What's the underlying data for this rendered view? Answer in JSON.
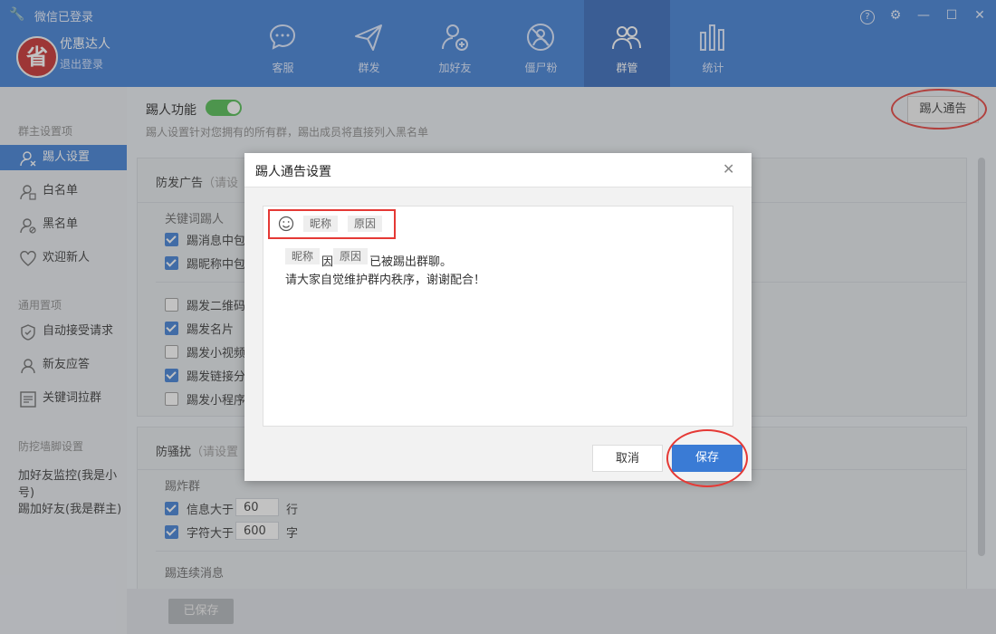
{
  "app": {
    "title": "微信已登录",
    "user_name": "优惠达人",
    "logout": "退出登录",
    "avatar_text": "省"
  },
  "nav_tabs": [
    {
      "label": "客服",
      "icon": "chat-icon"
    },
    {
      "label": "群发",
      "icon": "send-icon"
    },
    {
      "label": "加好友",
      "icon": "add-friend-icon"
    },
    {
      "label": "僵尸粉",
      "icon": "zombie-fan-icon"
    },
    {
      "label": "群管",
      "icon": "group-manage-icon",
      "active": true
    },
    {
      "label": "统计",
      "icon": "stats-icon"
    }
  ],
  "window_controls": {
    "help": "?",
    "settings": "⚙",
    "minimize": "—",
    "maximize": "☐",
    "close": "✕"
  },
  "sidebar": {
    "section1": "群主设置项",
    "items1": [
      "踢人设置",
      "白名单",
      "黑名单",
      "欢迎新人"
    ],
    "section2": "通用置项",
    "items2": [
      "自动接受请求",
      "新友应答",
      "关键词拉群"
    ],
    "section3": "防挖墙脚设置",
    "items3": [
      "加好友监控(我是小号)",
      "踢加好友(我是群主)"
    ]
  },
  "main": {
    "kick_title": "踢人功能",
    "kick_desc": "踢人设置针对您拥有的所有群，踢出成员将直接列入黑名单",
    "notice_button": "踢人通告",
    "anti_ad_title": "防发广告",
    "anti_ad_hint": "（请设",
    "keyword_kick": "关键词踢人",
    "kick_msg": "踢消息中包含",
    "kick_nick": "踢昵称中包含",
    "kick_qr": "踢发二维码(",
    "kick_card": "踢发名片",
    "kick_video": "踢发小视频",
    "kick_link": "踢发链接分享",
    "kick_mini": "踢发小程序",
    "anti_harass_title": "防骚扰",
    "anti_harass_hint": "（请设置",
    "bomb_group": "踢炸群",
    "msg_more": "信息大于",
    "msg_value": "60",
    "msg_unit": "行",
    "char_more": "字符大于",
    "char_value": "600",
    "char_unit": "字",
    "continuous": "踢连续消息",
    "saved_button": "已保存"
  },
  "dialog": {
    "title": "踢人通告设置",
    "close": "✕",
    "chip_nick": "昵称",
    "chip_reason": "原因",
    "text_because": "因",
    "text_kicked": "已被踢出群聊。",
    "text_line2": "请大家自觉维护群内秩序，谢谢配合！",
    "cancel": "取消",
    "save": "保存"
  },
  "colors": {
    "brand": "#3a7bd5",
    "toggle_on": "#4cbb4c",
    "annotation": "#e53935"
  }
}
